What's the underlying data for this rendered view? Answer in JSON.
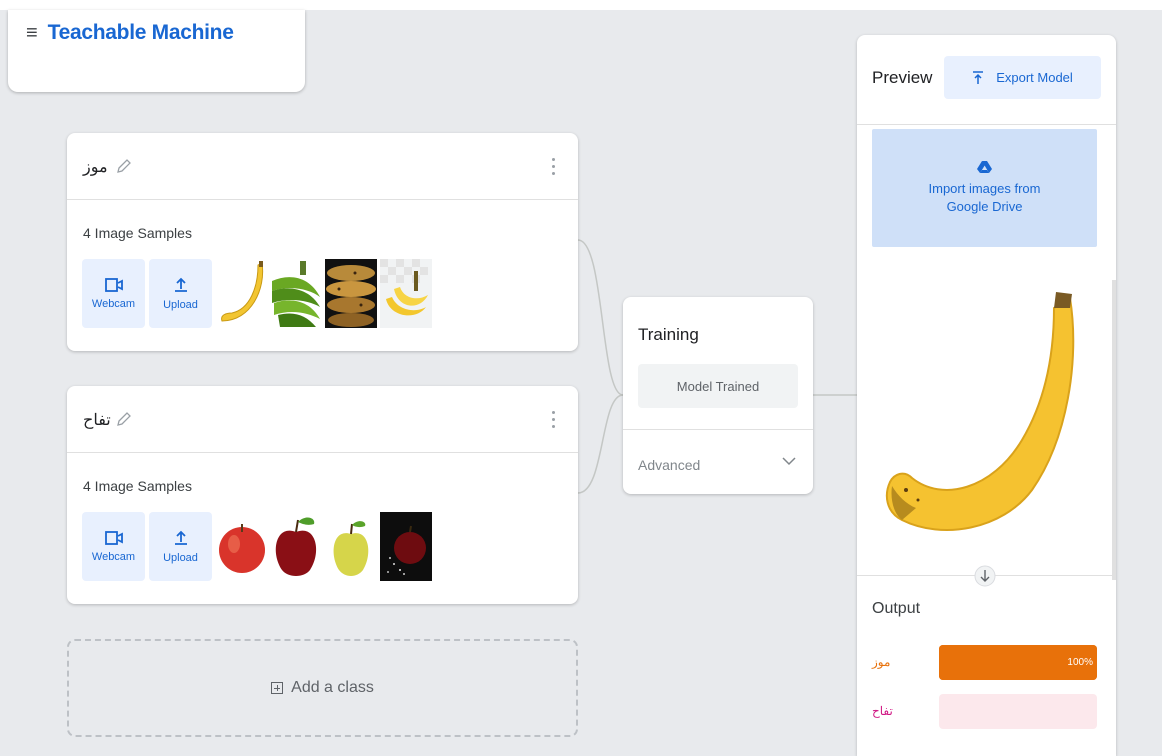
{
  "header": {
    "title": "Teachable Machine",
    "menu_icon": "hamburger-icon"
  },
  "classes": [
    {
      "name": "موز",
      "samples_label": "4 Image Samples",
      "webcam_label": "Webcam",
      "upload_label": "Upload",
      "thumbnails": [
        "banana-thumb",
        "green-bananas-thumb",
        "ripe-bananas-thumb",
        "banana-bunch-thumb"
      ]
    },
    {
      "name": "تفاح",
      "samples_label": "4 Image Samples",
      "webcam_label": "Webcam",
      "upload_label": "Upload",
      "thumbnails": [
        "red-apple-thumb",
        "dark-red-apple-thumb",
        "green-apple-thumb",
        "apple-dark-bg-thumb"
      ]
    }
  ],
  "add_class_label": "Add a class",
  "training": {
    "title": "Training",
    "button_label": "Model Trained",
    "advanced_label": "Advanced"
  },
  "preview": {
    "title": "Preview",
    "export_label": "Export Model",
    "drive_label": "Import images from Google Drive",
    "output_title": "Output",
    "outputs": [
      {
        "label": "موز",
        "value": 100,
        "percent_label": "100%",
        "color": "#e8710a",
        "track_color": "#e8710a"
      },
      {
        "label": "تفاح",
        "value": 0,
        "percent_label": "",
        "color": "#d01884",
        "track_color": "#fce8ec"
      }
    ]
  },
  "colors": {
    "accent": "#1967d2",
    "background": "#e8eaed"
  }
}
